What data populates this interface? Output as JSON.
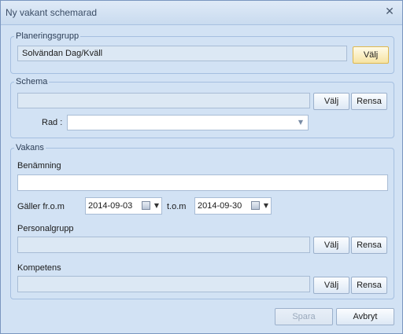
{
  "window": {
    "title": "Ny vakant schemarad",
    "close_glyph": "✕"
  },
  "planeringsgrupp": {
    "legend": "Planeringsgrupp",
    "value": "Solvändan Dag/Kväll",
    "choose_label": "Välj"
  },
  "schema": {
    "legend": "Schema",
    "value": "",
    "choose_label": "Välj",
    "clear_label": "Rensa",
    "row_label": "Rad :",
    "row_value": ""
  },
  "vakans": {
    "legend": "Vakans",
    "name_label": "Benämning",
    "name_value": "",
    "valid_from_label": "Gäller fr.o.m",
    "valid_from": "2014-09-03",
    "valid_to_label": "t.o.m",
    "valid_to": "2014-09-30",
    "personnel_group_label": "Personalgrupp",
    "personnel_group_value": "",
    "competence_label": "Kompetens",
    "competence_value": "",
    "choose_label": "Välj",
    "clear_label": "Rensa"
  },
  "footer": {
    "save_label": "Spara",
    "cancel_label": "Avbryt"
  },
  "icons": {
    "dropdown": "▼",
    "calendar": "calendar-icon"
  }
}
